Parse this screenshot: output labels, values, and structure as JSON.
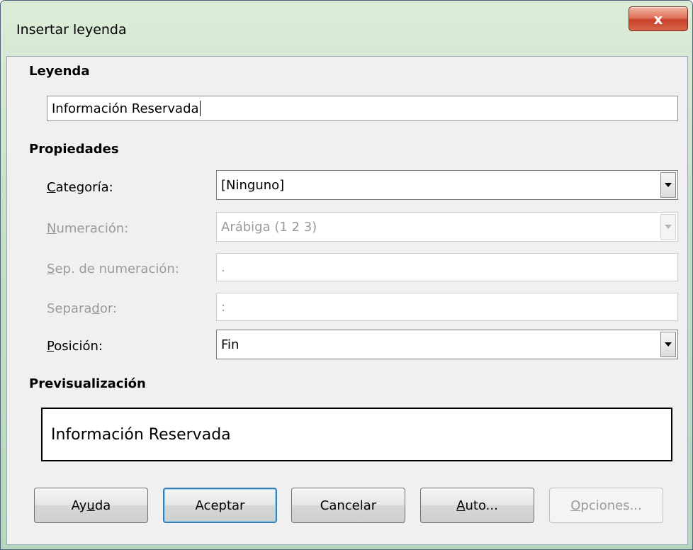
{
  "window": {
    "title": "Insertar leyenda",
    "close_label": "x"
  },
  "leyenda": {
    "heading": "Leyenda",
    "value": "Información Reservada"
  },
  "propiedades": {
    "heading": "Propiedades",
    "categoria": {
      "label_u": "C",
      "label_rest": "ategoría:",
      "value": "[Ninguno]"
    },
    "numeracion": {
      "label_u": "N",
      "label_rest": "umeración:",
      "value": "Arábiga (1 2 3)"
    },
    "sep_numeracion": {
      "label_u": "S",
      "label_rest": "ep. de numeración:",
      "value": "."
    },
    "separador": {
      "label_pre": "Separa",
      "label_u": "d",
      "label_rest": "or:",
      "value": ":"
    },
    "posicion": {
      "label_u": "P",
      "label_rest": "osición:",
      "value": "Fin"
    }
  },
  "preview": {
    "heading": "Previsualización",
    "text": "Información Reservada"
  },
  "buttons": {
    "ayuda": {
      "pre": "Ay",
      "u": "u",
      "rest": "da"
    },
    "aceptar": {
      "label": "Aceptar"
    },
    "cancelar": {
      "label": "Cancelar"
    },
    "auto": {
      "u": "A",
      "rest": "uto..."
    },
    "opciones": {
      "u": "O",
      "rest": "pciones..."
    }
  }
}
